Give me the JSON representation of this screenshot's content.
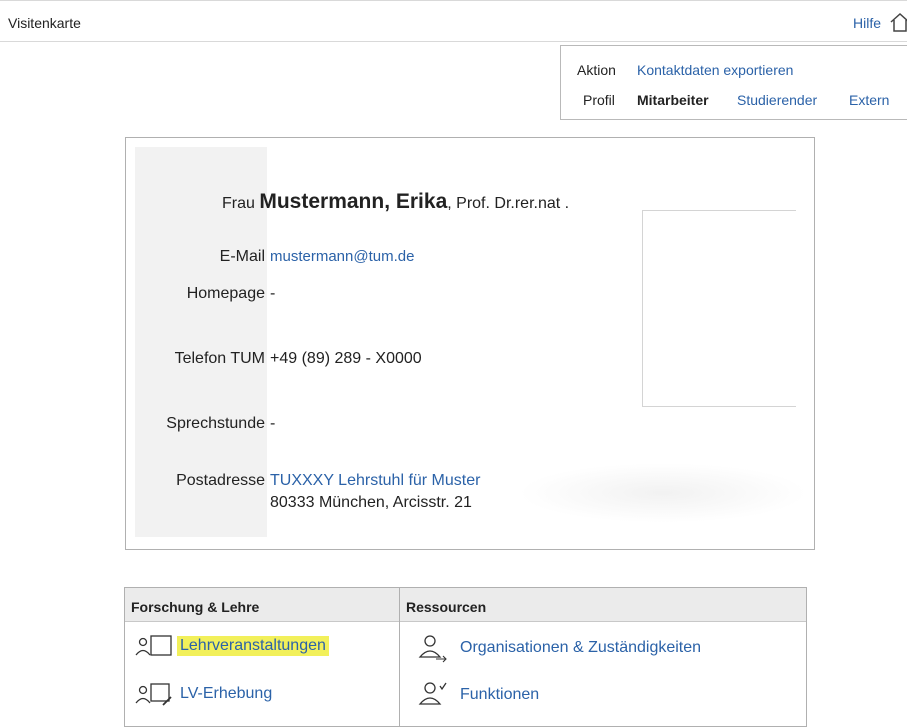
{
  "header": {
    "title": "Visitenkarte",
    "help": "Hilfe"
  },
  "actions": {
    "aktion_label": "Aktion",
    "export_link": "Kontaktdaten exportieren",
    "profil_label": "Profil",
    "profiles": [
      "Mitarbeiter",
      "Studierender",
      "Extern"
    ]
  },
  "card": {
    "salutation": "Frau",
    "name": "Mustermann, Erika",
    "title": ", Prof. Dr.rer.nat .",
    "email_label": "E-Mail",
    "email": "mustermann@tum.de",
    "homepage_label": "Homepage",
    "homepage": "-",
    "phone_label": "Telefon TUM",
    "phone": "+49 (89) 289 - X0000",
    "consult_label": "Sprechstunde",
    "consult": "-",
    "address_label": "Postadresse",
    "address_org": "TUXXXY Lehrstuhl für Muster",
    "address_street": "80333 München, Arcisstr. 21"
  },
  "panels": {
    "research": {
      "heading": "Forschung & Lehre",
      "items": [
        "Lehrveranstaltungen",
        "LV-Erhebung"
      ]
    },
    "resources": {
      "heading": "Ressourcen",
      "items": [
        "Organisationen & Zuständigkeiten",
        "Funktionen"
      ]
    }
  },
  "colors": {
    "link": "#2b62a8",
    "highlight": "#f2f05a",
    "panel_header": "#ebebeb"
  }
}
